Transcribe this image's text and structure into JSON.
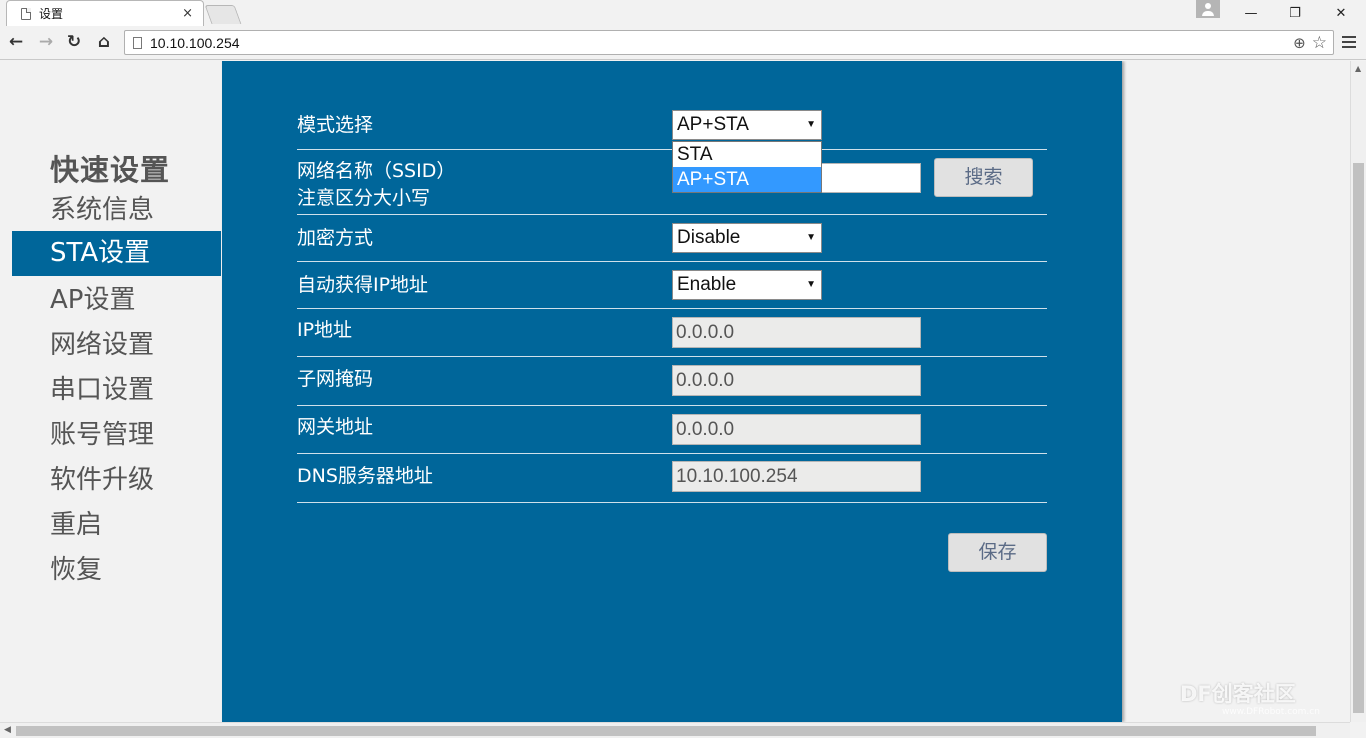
{
  "browser": {
    "tab_title": "设置",
    "tab_close": "×",
    "url": "10.10.100.254",
    "window_controls": {
      "minimize": "—",
      "maximize": "❐",
      "close": "✕"
    }
  },
  "sidebar": {
    "heading": "快速设置",
    "items": [
      {
        "label": "系统信息",
        "active": false
      },
      {
        "label": "STA设置",
        "active": true
      },
      {
        "label": "AP设置",
        "active": false
      },
      {
        "label": "网络设置",
        "active": false
      },
      {
        "label": "串口设置",
        "active": false
      },
      {
        "label": "账号管理",
        "active": false
      },
      {
        "label": "软件升级",
        "active": false
      },
      {
        "label": "重启",
        "active": false
      },
      {
        "label": "恢复",
        "active": false
      }
    ]
  },
  "form": {
    "mode": {
      "label": "模式选择",
      "value": "AP+STA",
      "options": [
        "STA",
        "AP+STA"
      ],
      "highlighted": "AP+STA"
    },
    "ssid": {
      "label_line1": "网络名称（SSID）",
      "label_line2": "注意区分大小写",
      "value": "",
      "search_button": "搜索"
    },
    "encryption": {
      "label": "加密方式",
      "value": "Disable"
    },
    "dhcp": {
      "label": "自动获得IP地址",
      "value": "Enable"
    },
    "ip": {
      "label": "IP地址",
      "value": "0.0.0.0"
    },
    "mask": {
      "label": "子网掩码",
      "value": "0.0.0.0"
    },
    "gateway": {
      "label": "网关地址",
      "value": "0.0.0.0"
    },
    "dns": {
      "label": "DNS服务器地址",
      "value": "10.10.100.254"
    },
    "save_button": "保存"
  },
  "watermark": {
    "text": "DF创客社区",
    "sub": "www.DFRobot.com.cn"
  },
  "colors": {
    "panel": "#00669a",
    "active_item": "#00669a",
    "highlight": "#3399ff"
  },
  "icons": [
    "page-icon",
    "back-arrow-icon",
    "forward-arrow-icon",
    "reload-icon",
    "home-icon",
    "zoom-icon",
    "star-icon",
    "menu-icon",
    "profile-icon",
    "caret-down-icon"
  ]
}
